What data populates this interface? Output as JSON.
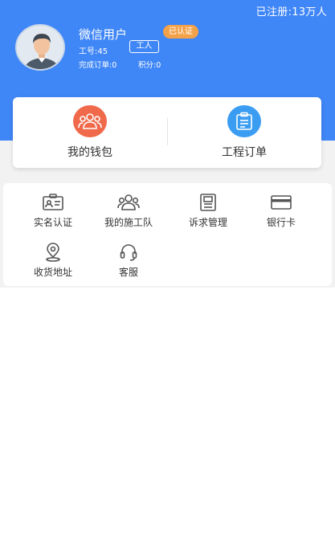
{
  "status_bar": {
    "registered_label": "已注册:13万人"
  },
  "profile": {
    "name": "微信用户",
    "role_tag": "工人",
    "verified_badge": "已认证",
    "worker_id": "工号:45",
    "completed_orders": "完成订单:0",
    "points": "积分:0"
  },
  "quick_card": {
    "wallet_label": "我的钱包",
    "project_orders_label": "工程订单",
    "wallet_icon": "team-icon",
    "orders_icon": "clipboard-icon",
    "colors": {
      "wallet_circle": "#f0694a",
      "orders_circle": "#3b9df2"
    }
  },
  "menu": {
    "items": [
      {
        "label": "实名认证",
        "icon": "id-card-icon"
      },
      {
        "label": "我的施工队",
        "icon": "team-icon"
      },
      {
        "label": "诉求管理",
        "icon": "document-icon"
      },
      {
        "label": "银行卡",
        "icon": "bank-card-icon"
      },
      {
        "label": "收货地址",
        "icon": "location-pin-icon"
      },
      {
        "label": "客服",
        "icon": "headset-icon"
      }
    ]
  },
  "theme": {
    "primary": "#3f86f6",
    "badge": "#f3a24a"
  }
}
